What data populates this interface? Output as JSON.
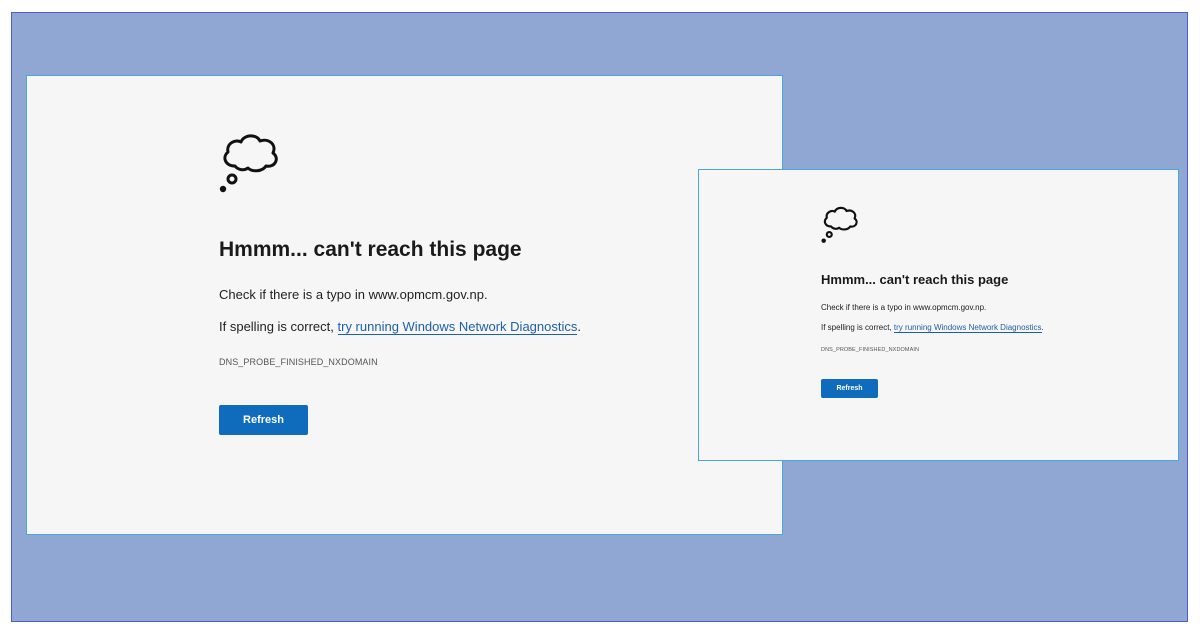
{
  "error_page": {
    "icon": "thought-bubble-icon",
    "headline": "Hmmm... can't reach this page",
    "typo_prefix": "Check if there is a typo in ",
    "domain": "www.opmcm.gov.np",
    "typo_suffix": ".",
    "spelling_prefix": "If spelling is correct, ",
    "diagnostics_link": "try running Windows Network Diagnostics",
    "spelling_suffix": ".",
    "error_code": "DNS_PROBE_FINISHED_NXDOMAIN",
    "refresh_label": "Refresh"
  },
  "colors": {
    "backdrop": "#91a7d3",
    "panel": "#f6f6f6",
    "panel_border": "#4aa7de",
    "button": "#0f6cbd",
    "link": "#1f5fa9"
  }
}
